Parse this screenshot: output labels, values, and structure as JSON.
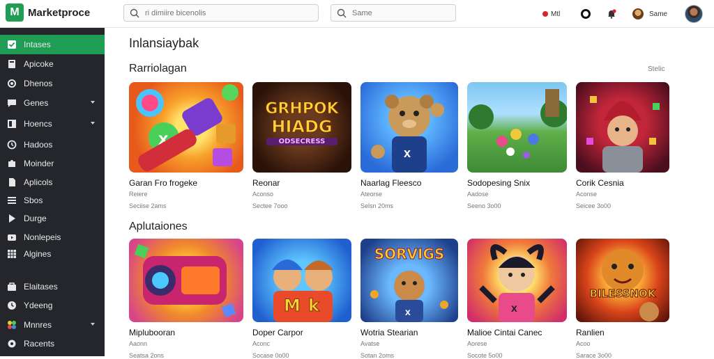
{
  "app": {
    "name": "Marketproce",
    "logo_letter": "M"
  },
  "search": {
    "primary_placeholder": "ri dimiire bicenolis",
    "secondary_placeholder": "Same"
  },
  "topbar": {
    "item1_label": "Mtl",
    "user_label": "Same"
  },
  "sidebar": {
    "items": [
      {
        "label": "Intases",
        "icon": "check-square-icon",
        "active": true,
        "caret": false
      },
      {
        "label": "Apicoke",
        "icon": "book-icon",
        "active": false,
        "caret": false
      },
      {
        "label": "Dhenos",
        "icon": "circle-icon",
        "active": false,
        "caret": false
      },
      {
        "label": "Genes",
        "icon": "chat-icon",
        "active": false,
        "caret": true
      },
      {
        "label": "Hoencs",
        "icon": "layout-icon",
        "active": false,
        "caret": true
      },
      {
        "label": "Hadoos",
        "icon": "history-icon",
        "active": false,
        "caret": false
      },
      {
        "label": "Moinder",
        "icon": "puzzle-icon",
        "active": false,
        "caret": false
      },
      {
        "label": "Aplicols",
        "icon": "file-icon",
        "active": false,
        "caret": false
      },
      {
        "label": "Sbos",
        "icon": "list-icon",
        "active": false,
        "caret": false
      },
      {
        "label": "Durge",
        "icon": "play-icon",
        "active": false,
        "caret": false
      },
      {
        "label": "Nonlepeis",
        "icon": "video-icon",
        "active": false,
        "caret": false
      },
      {
        "label": "Algines",
        "icon": "grid-icon",
        "active": false,
        "caret": false
      },
      {
        "label": "Elaitases",
        "icon": "bag-icon",
        "active": false,
        "caret": false
      },
      {
        "label": "Ydeeng",
        "icon": "clock-icon",
        "active": false,
        "caret": false
      },
      {
        "label": "Mnnres",
        "icon": "apps-icon",
        "active": false,
        "caret": true
      },
      {
        "label": "Racents",
        "icon": "settings-icon",
        "active": false,
        "caret": false
      }
    ]
  },
  "main": {
    "title": "Inlansiaybak",
    "sections": [
      {
        "title": "Rarriolagan",
        "see_all": "Stelic",
        "cards": [
          {
            "name": "Garan Fro frogeke",
            "category": "Reiere",
            "meta": "Seciise  2ams"
          },
          {
            "name": "Reonar",
            "category": "Aconso",
            "meta": "Sectee  7ooo"
          },
          {
            "name": "Naarlag Fleesco",
            "category": "Ateorse",
            "meta": "Selsn  20ms"
          },
          {
            "name": "Sodopesing Snix",
            "category": "Aadose",
            "meta": "Seeno  3o00"
          },
          {
            "name": "Corik Cesnia",
            "category": "Aconse",
            "meta": "Seicee  3o00"
          }
        ]
      },
      {
        "title": "Aplutaiones",
        "cards": [
          {
            "name": "Miplubooran",
            "category": "Aaonn",
            "meta": "Seatsa  2ons"
          },
          {
            "name": "Doper Carpor",
            "category": "Aconc",
            "meta": "Socase  0o00"
          },
          {
            "name": "Wotria Stearian",
            "category": "Avatse",
            "meta": "Sotan  2oms"
          },
          {
            "name": "Malioe Cintai Canec",
            "category": "Aorese",
            "meta": "Socote  5o00"
          },
          {
            "name": "Ranlien",
            "category": "Acoo",
            "meta": "Sarace  3o00"
          }
        ]
      }
    ]
  },
  "thumb_text": {
    "t2_line1": "GRHPOK",
    "t2_line2": "HIADG",
    "t2_line3": "ODSECRESS",
    "t7_line1": "M",
    "t7_line2": "k",
    "t8_line1": "SORVIGS",
    "t10_line1": "BILESSNOK"
  },
  "colors": {
    "accent": "#1f9d55",
    "sidebar_bg": "#24262b",
    "sidebar_text": "#e8e8e8"
  }
}
